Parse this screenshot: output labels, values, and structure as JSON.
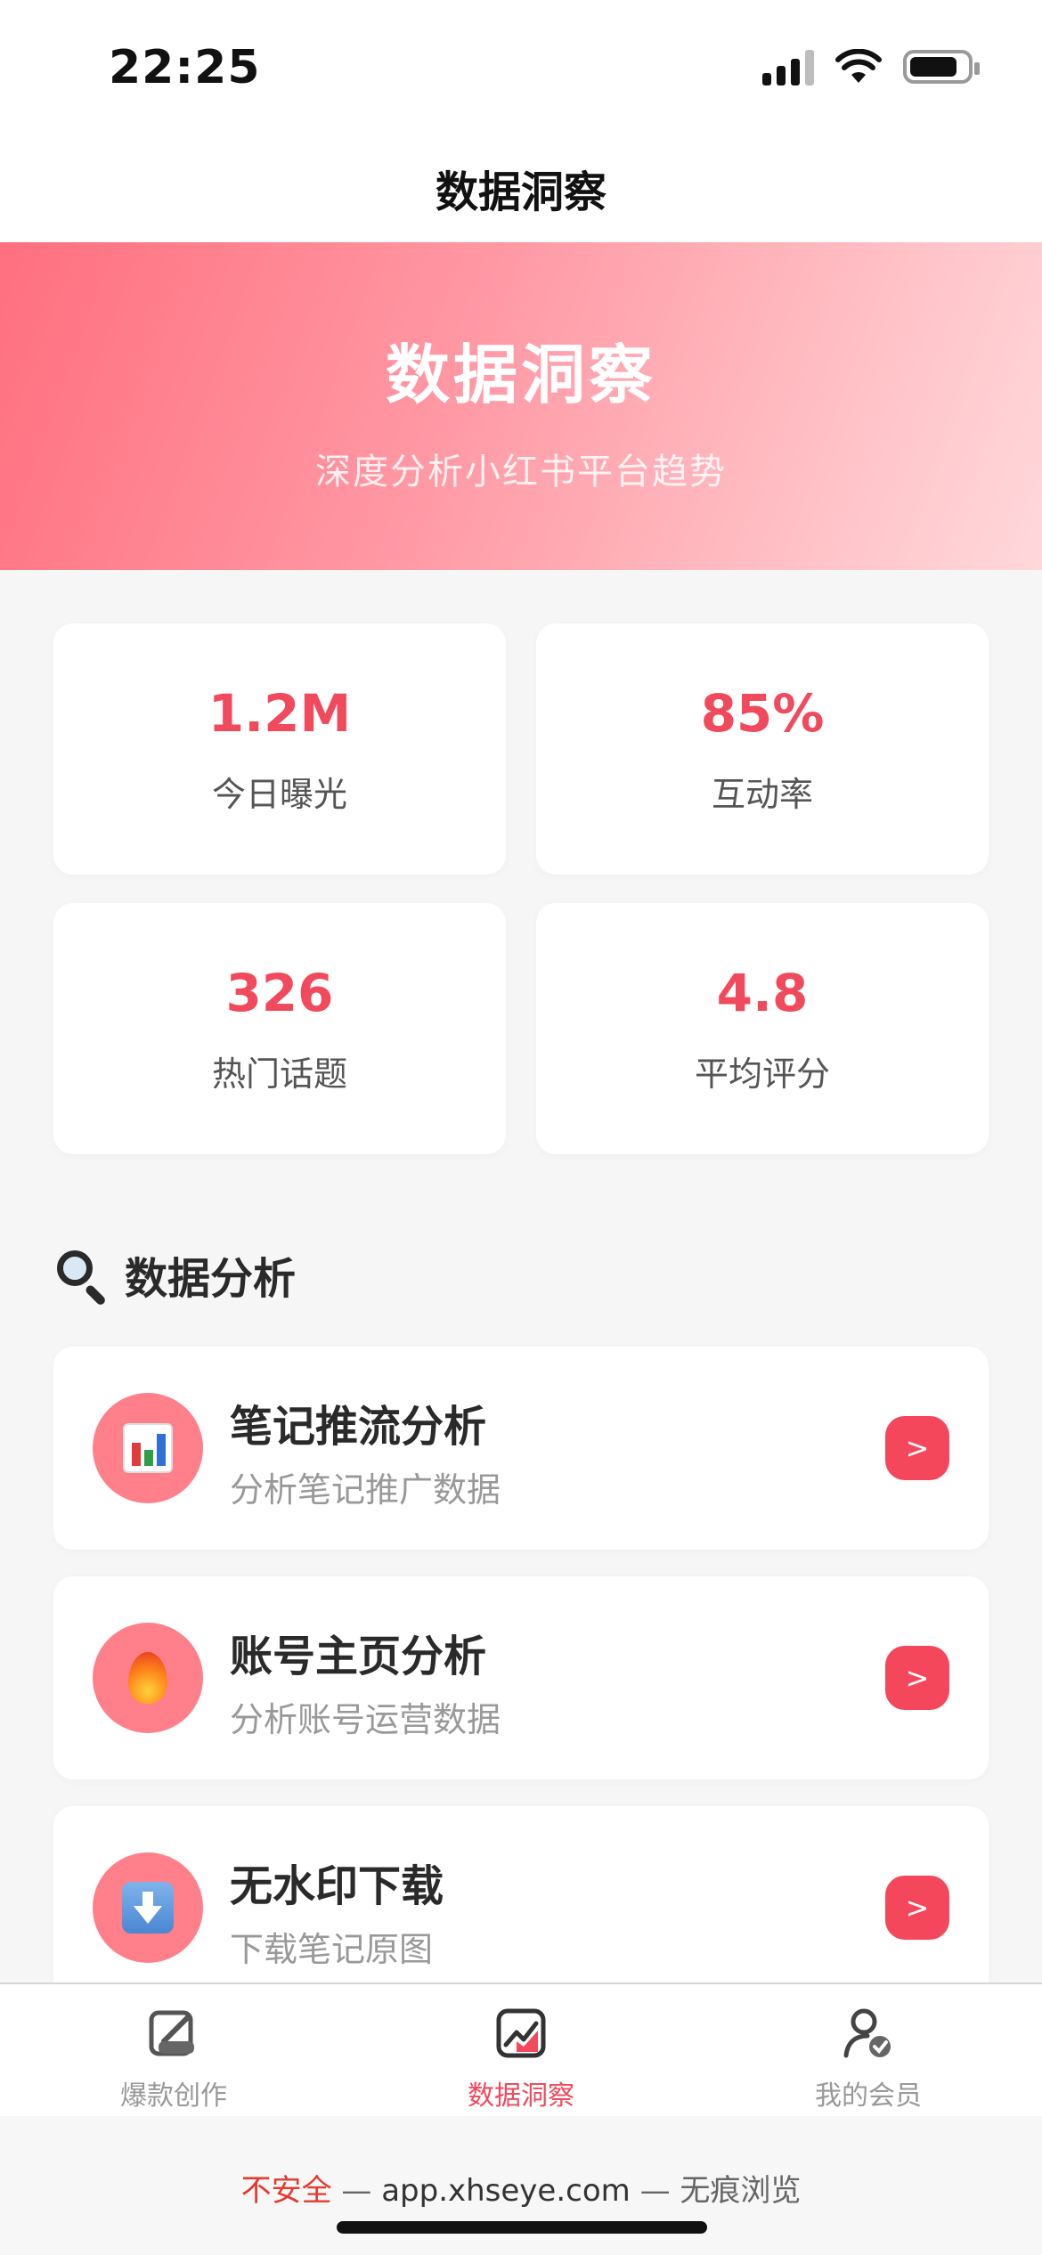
{
  "status_bar": {
    "time": "22:25"
  },
  "nav": {
    "title": "数据洞察"
  },
  "hero": {
    "title": "数据洞察",
    "subtitle": "深度分析小红书平台趋势"
  },
  "stats": [
    {
      "value": "1.2M",
      "label": "今日曝光"
    },
    {
      "value": "85%",
      "label": "互动率"
    },
    {
      "value": "326",
      "label": "热门话题"
    },
    {
      "value": "4.8",
      "label": "平均评分"
    }
  ],
  "section": {
    "title": "数据分析",
    "icon": "magnifier-icon"
  },
  "items": [
    {
      "title": "笔记推流分析",
      "subtitle": "分析笔记推广数据",
      "icon": "bar-chart-icon",
      "button": ">"
    },
    {
      "title": "账号主页分析",
      "subtitle": "分析账号运营数据",
      "icon": "fire-icon",
      "button": ">"
    },
    {
      "title": "无水印下载",
      "subtitle": "下载笔记原图",
      "icon": "download-icon",
      "button": ">"
    }
  ],
  "tabs": [
    {
      "label": "爆款创作",
      "icon": "create-icon",
      "active": false
    },
    {
      "label": "数据洞察",
      "icon": "chart-icon",
      "active": true
    },
    {
      "label": "我的会员",
      "icon": "member-icon",
      "active": false
    }
  ],
  "url_bar": {
    "warning": "不安全",
    "separator": "—",
    "domain": "app.xhseye.com",
    "mode": "无痕浏览"
  },
  "colors": {
    "accent": "#f04a5c",
    "hero_start": "#ff6f7f",
    "hero_end": "#ffd8db"
  }
}
